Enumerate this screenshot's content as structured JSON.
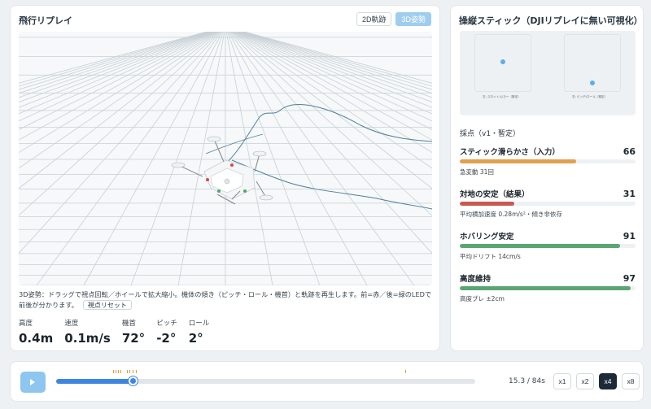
{
  "left_panel": {
    "title": "飛行リプレイ",
    "view_tabs": [
      {
        "label": "2D軌跡",
        "active": false
      },
      {
        "label": "3D姿勢",
        "active": true
      }
    ],
    "description": "3D姿勢：ドラッグで視点回転／ホイールで拡大縮小。機体の傾き（ピッチ・ロール・機首）と軌跡を再生します。前=赤／後=緑のLEDで前後が分かります。",
    "reset_label": "視点リセット",
    "metrics": [
      {
        "label": "高度",
        "value": "0.4m"
      },
      {
        "label": "速度",
        "value": "0.1m/s"
      },
      {
        "label": "機首",
        "value": "72°"
      },
      {
        "label": "ピッチ",
        "value": "-2°"
      },
      {
        "label": "ロール",
        "value": "2°"
      }
    ]
  },
  "right_panel": {
    "title": "操縦スティック（DJIリプレイに無い可視化）",
    "sticks": {
      "left_caption": "左: スロットル/ヨー（推定）",
      "right_caption": "右: ピッチ/ロール（推定）"
    },
    "scoring_title": "採点（v1・暫定）",
    "scores": [
      {
        "name": "スティック滑らかさ（入力）",
        "value": 66,
        "note": "急変動 31回",
        "color": "#e0a050"
      },
      {
        "name": "対地の安定（結果）",
        "value": 31,
        "note": "平均横加速度 0.28m/s²・傾き非依存",
        "color": "#c85a50"
      },
      {
        "name": "ホバリング安定",
        "value": 91,
        "note": "平均ドリフト 14cm/s",
        "color": "#5aa672"
      },
      {
        "name": "高度維持",
        "value": 97,
        "note": "高度ブレ ±2cm",
        "color": "#5aa672"
      }
    ]
  },
  "playback": {
    "progress": 0.182,
    "time": "15.3 / 84s",
    "speeds": [
      {
        "label": "x1",
        "active": false
      },
      {
        "label": "x2",
        "active": false
      },
      {
        "label": "x4",
        "active": true
      },
      {
        "label": "x8",
        "active": false
      }
    ]
  }
}
